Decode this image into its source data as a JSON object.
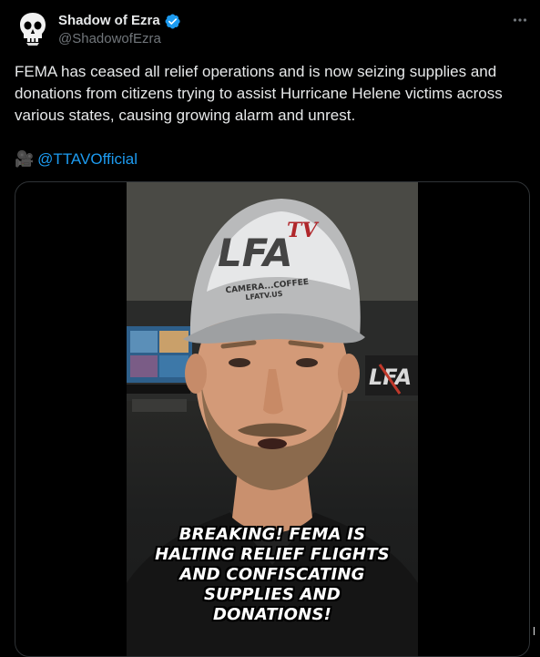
{
  "author": {
    "display_name": "Shadow of Ezra",
    "handle": "@ShadowofEzra",
    "avatar_icon": "skull-avatar",
    "verified": true
  },
  "tweet": {
    "text": "FEMA has ceased all relief operations and is now seizing supplies and donations from citizens trying to assist Hurricane Helene victims across various states, causing growing alarm and unrest.",
    "credit_emoji": "🎥",
    "credit_mention": "@TTAVOfficial"
  },
  "media": {
    "cap_logo": "LFA",
    "cap_logo_sub": "TV",
    "cap_text_1": "CAMERA...COFFEE",
    "cap_text_2": "LFATV.US",
    "bg_logo": "LFA",
    "caption_lines": [
      "BREAKING! FEMA IS",
      "HALTING RELIEF FLIGHTS",
      "AND CONFISCATING",
      "SUPPLIES AND",
      "DONATIONS!"
    ]
  },
  "colors": {
    "background": "#000000",
    "text": "#e7e9ea",
    "secondary": "#71767b",
    "accent": "#1d9bf0",
    "border": "#2f3336"
  }
}
